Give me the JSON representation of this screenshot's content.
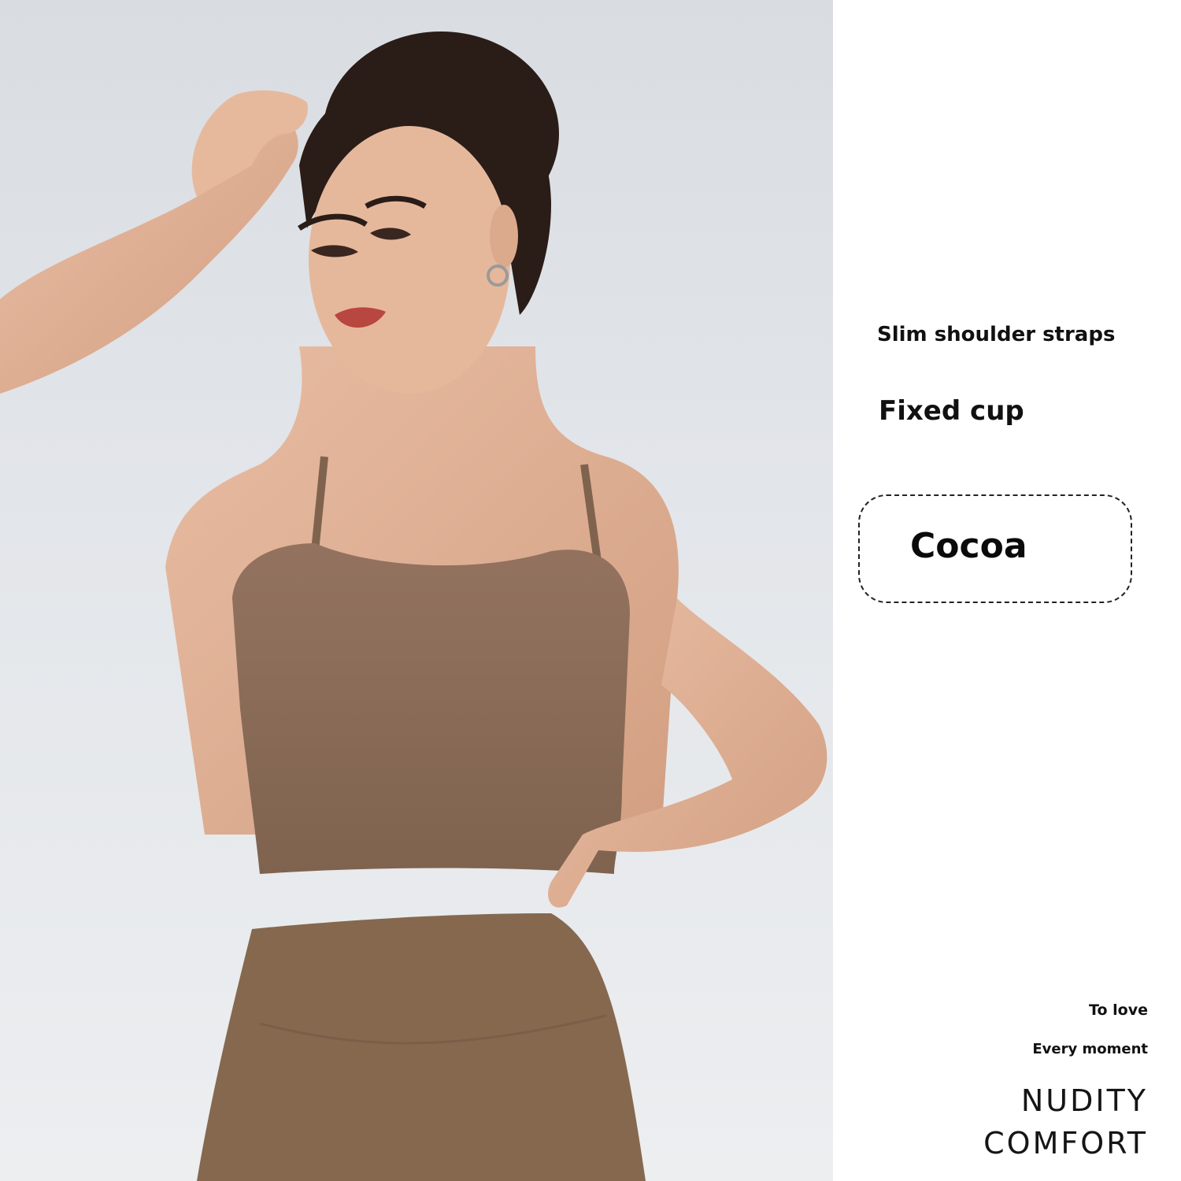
{
  "features": {
    "straps": "Slim shoulder straps",
    "cup": "Fixed cup"
  },
  "color_tag": {
    "name": "Cocoa"
  },
  "taglines": {
    "line1": "To love",
    "line2": "Every moment"
  },
  "slogan": {
    "line1": "NUDITY",
    "line2": "COMFORT"
  },
  "colors": {
    "product": "#8a6d5a",
    "background": "#e0e3e7",
    "skin": "#e2b195",
    "hair": "#2a1c17"
  }
}
